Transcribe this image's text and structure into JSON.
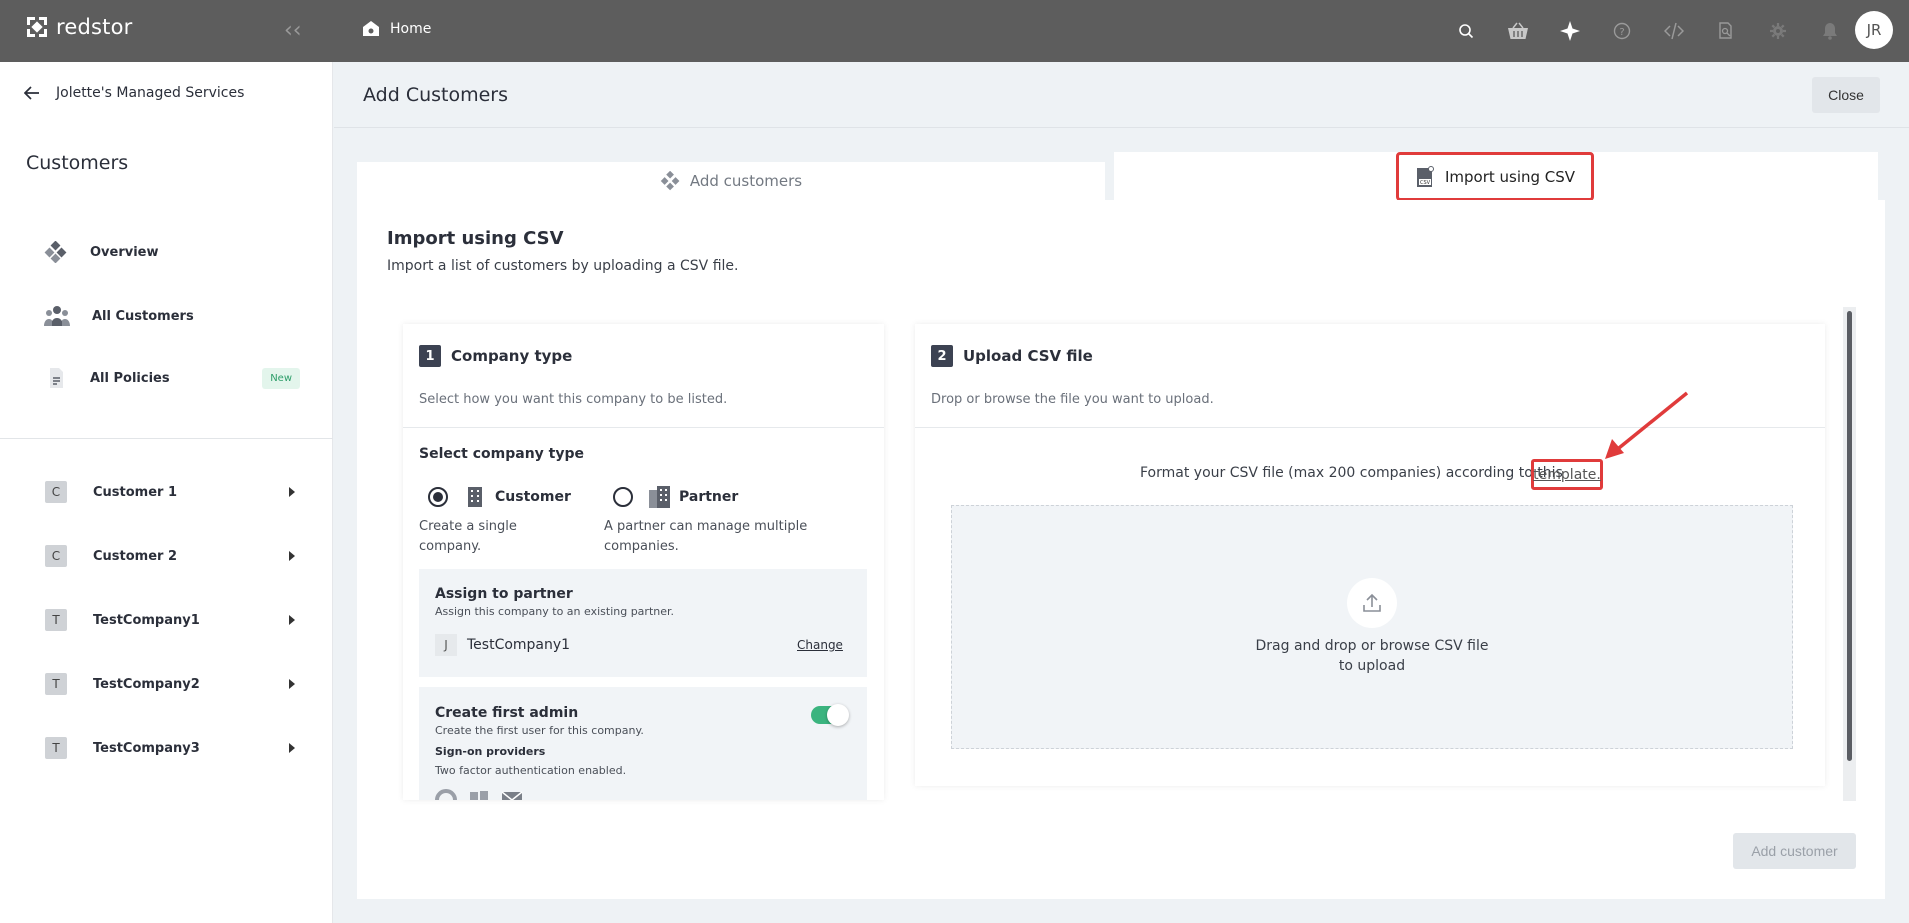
{
  "topbar": {
    "brand": "redstor",
    "breadcrumb": "Home",
    "avatar_initials": "JR",
    "icons": [
      "search-icon",
      "basket-icon",
      "sparkle-icon",
      "help-icon",
      "code-icon",
      "search-doc-icon",
      "gear-icon",
      "bell-icon"
    ]
  },
  "sidebar": {
    "back_label": "Jolette's Managed Services",
    "title": "Customers",
    "nav": [
      {
        "label": "Overview",
        "icon": "overview-icon"
      },
      {
        "label": "All Customers",
        "icon": "people-icon"
      },
      {
        "label": "All Policies",
        "icon": "document-icon",
        "badge": "New"
      }
    ],
    "customers": [
      {
        "initial": "C",
        "label": "Customer 1"
      },
      {
        "initial": "C",
        "label": "Customer 2"
      },
      {
        "initial": "T",
        "label": "TestCompany1"
      },
      {
        "initial": "T",
        "label": "TestCompany2"
      },
      {
        "initial": "T",
        "label": "TestCompany3"
      }
    ]
  },
  "header": {
    "title": "Add Customers",
    "close_label": "Close"
  },
  "tabs": {
    "add": "Add customers",
    "import": "Import using CSV"
  },
  "import": {
    "title": "Import using CSV",
    "subtitle": "Import a list of customers by uploading a CSV file.",
    "add_button": "Add customer"
  },
  "step1": {
    "num": "1",
    "title": "Company type",
    "subtitle": "Select how you want this company to be listed.",
    "select_label": "Select company type",
    "option_customer": "Customer",
    "option_customer_desc": "Create a single company.",
    "option_partner": "Partner",
    "option_partner_desc": "A partner can manage multiple companies.",
    "selected": "Customer",
    "assign": {
      "title": "Assign to partner",
      "subtitle": "Assign this company to an existing partner.",
      "initial": "J",
      "partner": "TestCompany1",
      "change": "Change"
    },
    "admin": {
      "title": "Create first admin",
      "subtitle": "Create the first user for this company.",
      "enabled": true,
      "providers_title": "Sign-on providers",
      "providers_sub": "Two factor authentication enabled."
    }
  },
  "step2": {
    "num": "2",
    "title": "Upload CSV file",
    "subtitle": "Drop or browse the file you want to upload.",
    "format_text": "Format your CSV file (max 200 companies) according to this",
    "template_link": "template.",
    "drop_line1": "Drag and drop or browse CSV file",
    "drop_line2": "to upload"
  },
  "colors": {
    "topbar": "#5d5d5d",
    "highlight": "#e03b3b",
    "toggle": "#3bb47f",
    "badge": "#2e9e6a"
  }
}
